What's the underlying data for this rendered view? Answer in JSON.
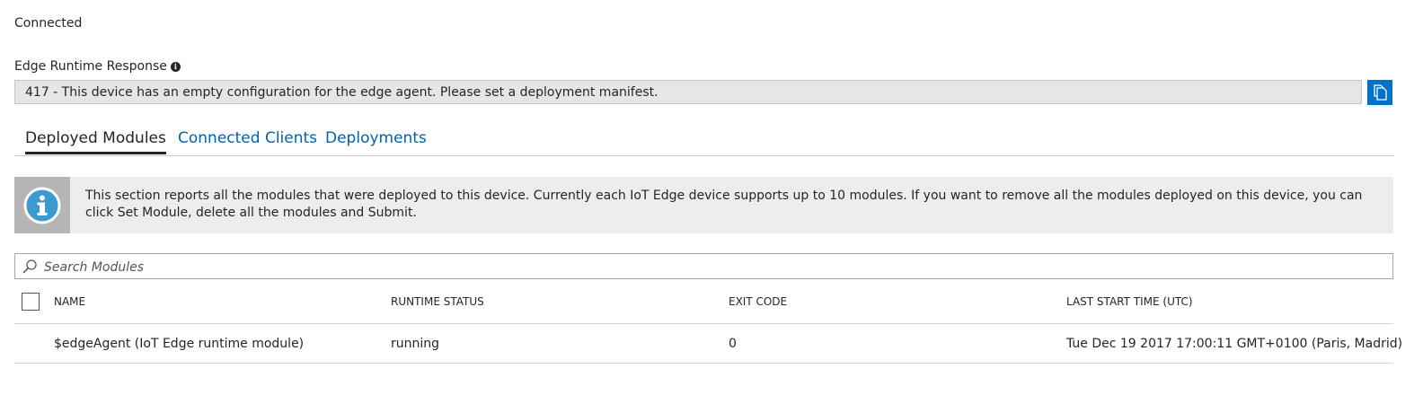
{
  "connection": {
    "status": "Connected"
  },
  "edge_runtime": {
    "label": "Edge Runtime Response",
    "info_icon": "info-icon",
    "response": "417 - This device has an empty configuration for the edge agent. Please set a deployment manifest.",
    "copy_icon": "copy-icon"
  },
  "tabs": [
    {
      "label": "Deployed Modules",
      "active": true
    },
    {
      "label": "Connected Clients",
      "active": false
    },
    {
      "label": "Deployments",
      "active": false
    }
  ],
  "info_banner": {
    "icon": "info-circle-icon",
    "text": "This section reports all the modules that were deployed to this device. Currently each IoT Edge device supports up to 10 modules. If you want to remove all the modules deployed on this device, you can click Set Module, delete all the modules and Submit."
  },
  "search": {
    "placeholder": "Search Modules",
    "value": "",
    "icon": "search-icon"
  },
  "table": {
    "headers": [
      "NAME",
      "RUNTIME STATUS",
      "EXIT CODE",
      "LAST START TIME (UTC)"
    ],
    "rows": [
      {
        "name": "$edgeAgent (IoT Edge runtime module)",
        "runtime_status": "running",
        "exit_code": "0",
        "last_start_time": "Tue Dec 19 2017 17:00:11 GMT+0100 (Paris, Madrid)"
      }
    ]
  },
  "colors": {
    "accent": "#0072c6",
    "link": "#0063b1",
    "response_bg": "#e6e6e6",
    "banner_bg": "#ededed",
    "banner_icon_bg": "#b5b5b5",
    "info_icon_fill": "#3c9ad0"
  }
}
